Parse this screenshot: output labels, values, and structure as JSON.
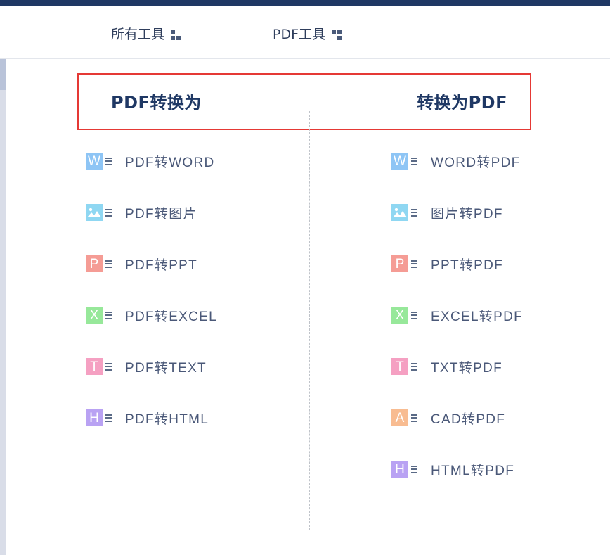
{
  "nav": {
    "all_tools": "所有工具",
    "pdf_tools": "PDF工具"
  },
  "columns": {
    "left_title": "PDF转换为",
    "right_title": "转换为PDF"
  },
  "left_tools": [
    {
      "label": "PDF转WORD",
      "badge": "W",
      "icon": "word-icon",
      "color": "#8ec5f5"
    },
    {
      "label": "PDF转图片",
      "badge": "",
      "icon": "image-icon",
      "color": "#8fd7f2"
    },
    {
      "label": "PDF转PPT",
      "badge": "P",
      "icon": "ppt-icon",
      "color": "#f59c95"
    },
    {
      "label": "PDF转EXCEL",
      "badge": "X",
      "icon": "excel-icon",
      "color": "#97e89a"
    },
    {
      "label": "PDF转TEXT",
      "badge": "T",
      "icon": "text-icon",
      "color": "#f5a0c2"
    },
    {
      "label": "PDF转HTML",
      "badge": "H",
      "icon": "html-icon",
      "color": "#b9a2f3"
    }
  ],
  "right_tools": [
    {
      "label": "WORD转PDF",
      "badge": "W",
      "icon": "word-icon",
      "color": "#8ec5f5"
    },
    {
      "label": "图片转PDF",
      "badge": "",
      "icon": "image-icon",
      "color": "#8fd7f2"
    },
    {
      "label": "PPT转PDF",
      "badge": "P",
      "icon": "ppt-icon",
      "color": "#f59c95"
    },
    {
      "label": "EXCEL转PDF",
      "badge": "X",
      "icon": "excel-icon",
      "color": "#97e89a"
    },
    {
      "label": "TXT转PDF",
      "badge": "T",
      "icon": "text-icon",
      "color": "#f5a0c2"
    },
    {
      "label": "CAD转PDF",
      "badge": "A",
      "icon": "cad-icon",
      "color": "#f8bc91"
    },
    {
      "label": "HTML转PDF",
      "badge": "H",
      "icon": "html-icon",
      "color": "#b9a2f3"
    }
  ],
  "colors": {
    "brand_navy": "#1f3864",
    "highlight_border": "#e53935"
  }
}
